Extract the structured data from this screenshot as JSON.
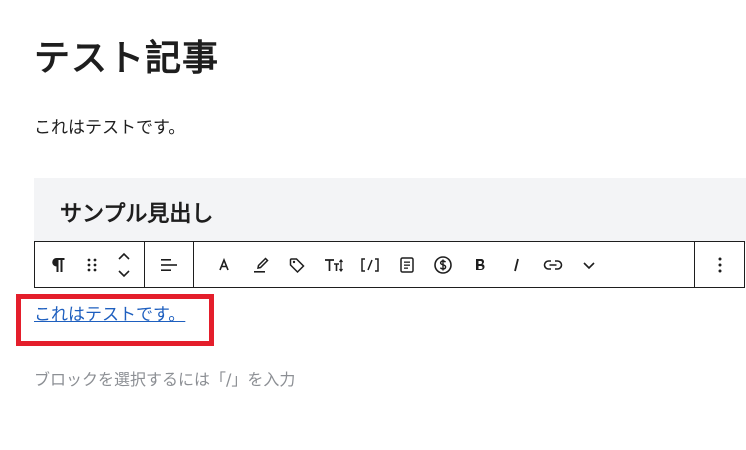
{
  "editor": {
    "post_title": "テスト記事",
    "paragraph_1": "これはテストです。",
    "heading_block": "サンプル見出し",
    "selected_paragraph": "これはテストです。",
    "placeholder": "ブロックを選択するには「/」を入力"
  },
  "toolbar": {
    "block_type_icon": "paragraph-icon",
    "drag_icon": "drag-handle-icon",
    "move_up_icon": "chevron-up-icon",
    "move_down_icon": "chevron-down-icon",
    "align_icon": "align-left-icon",
    "items": [
      {
        "name": "font-icon",
        "symbol": "A"
      },
      {
        "name": "highlight-icon",
        "symbol": "brush"
      },
      {
        "name": "tag-icon",
        "symbol": "tag"
      },
      {
        "name": "font-size-icon",
        "symbol": "T↕"
      },
      {
        "name": "shortcode-icon",
        "symbol": "[/]"
      },
      {
        "name": "document-icon",
        "symbol": "doc"
      },
      {
        "name": "dollar-icon",
        "symbol": "$"
      },
      {
        "name": "bold-icon",
        "symbol": "B"
      },
      {
        "name": "italic-icon",
        "symbol": "I"
      },
      {
        "name": "link-icon",
        "symbol": "link"
      },
      {
        "name": "more-formats-icon",
        "symbol": "chevron"
      }
    ],
    "options_icon": "vertical-ellipsis-icon"
  },
  "colors": {
    "highlight_border": "#e41e2b",
    "link_text": "#1e5fbf",
    "heading_block_bg": "#f3f4f6",
    "placeholder_text": "#8c8f94"
  }
}
